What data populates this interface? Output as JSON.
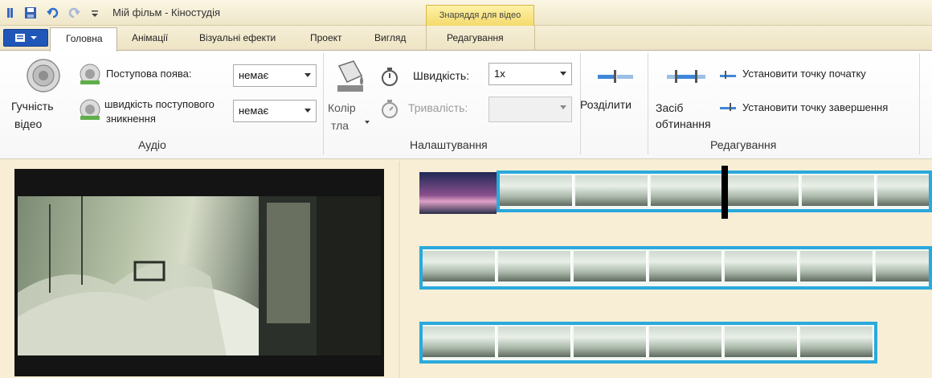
{
  "title_bar": {
    "app_title": "Мій фільм - Кіностудія",
    "context_group": "Знаряддя для відео"
  },
  "tabs": {
    "home": "Головна",
    "animations": "Анімації",
    "visual_effects": "Візуальні ефекти",
    "project": "Проект",
    "view": "Вигляд",
    "editing": "Редагування"
  },
  "audio_group": {
    "video_volume_line1": "Гучність",
    "video_volume_line2": "відео",
    "fade_in_label": "Поступова поява:",
    "fade_in_value": "немає",
    "fade_out_label_line1": "швидкість поступового",
    "fade_out_label_line2": "зникнення",
    "fade_out_value": "немає",
    "group_label": "Аудіо"
  },
  "adjust_group": {
    "bg_color_line1": "Колір",
    "bg_color_line2": "тла",
    "speed_label": "Швидкість:",
    "speed_value": "1x",
    "duration_label": "Тривалість:",
    "duration_value": "",
    "group_label": "Налаштування"
  },
  "edit_group": {
    "split": "Розділити",
    "trim_tool_line1": "Засіб",
    "trim_tool_line2": "обтинання",
    "set_start": "Установити точку початку",
    "set_end": "Установити точку завершення",
    "group_label": "Редагування"
  }
}
